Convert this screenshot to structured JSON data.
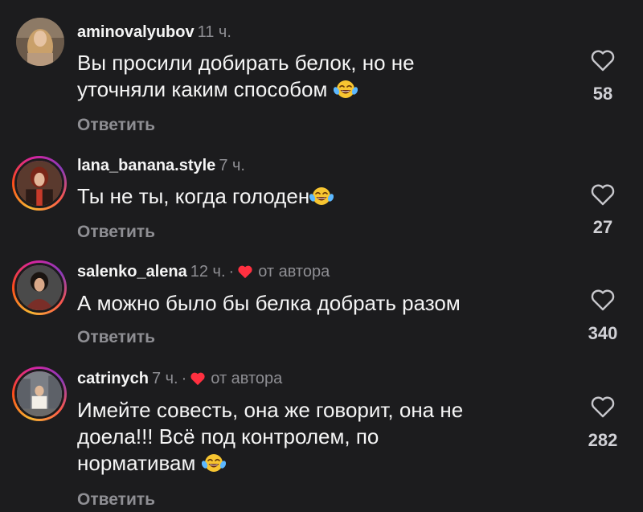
{
  "comments": [
    {
      "username": "aminovalyubov",
      "time": "11 ч.",
      "text_lines": [
        "Вы просили добирать белок, но не",
        "уточняли каким способом"
      ],
      "emoji": "😂",
      "reply_label": "Ответить",
      "likes": "58",
      "author_liked": false,
      "has_story_ring": false
    },
    {
      "username": "lana_banana.style",
      "time": "7 ч.",
      "text_lines": [
        "Ты не ты, когда голоден"
      ],
      "emoji": "😂",
      "reply_label": "Ответить",
      "likes": "27",
      "author_liked": false,
      "has_story_ring": true
    },
    {
      "username": "salenko_alena",
      "time": "12 ч.",
      "separator": "·",
      "author_label": "от автора",
      "text_lines": [
        "А можно было бы белка добрать разом"
      ],
      "reply_label": "Ответить",
      "likes": "340",
      "author_liked": true,
      "has_story_ring": true
    },
    {
      "username": "catrinych",
      "time": "7 ч.",
      "separator": "·",
      "author_label": "от автора",
      "text_lines": [
        "Имейте совесть, она же говорит, она не",
        "доела!!! Всё под контролем, по",
        "нормативам"
      ],
      "emoji": "😂",
      "reply_label": "Ответить",
      "likes": "282",
      "author_liked": true,
      "has_story_ring": true
    }
  ],
  "colors": {
    "background": "#1c1c1e",
    "secondary_text": "#8e8e93",
    "heart_red": "#ff3040"
  },
  "icons": {
    "like": "heart-outline-icon",
    "author_like": "heart-filled-icon",
    "emoji": "face-with-tears-of-joy-icon"
  }
}
